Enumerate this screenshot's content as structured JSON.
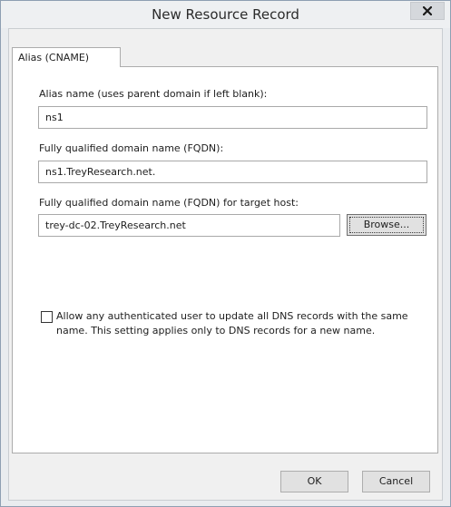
{
  "window": {
    "title": "New Resource Record"
  },
  "tabs": [
    {
      "label": "Alias (CNAME)",
      "selected": true
    }
  ],
  "form": {
    "alias_label": "Alias name (uses parent domain if left blank):",
    "alias_value": "ns1",
    "fqdn_label": "Fully qualified domain name (FQDN):",
    "fqdn_value": "ns1.TreyResearch.net.",
    "target_label": "Fully qualified domain name (FQDN) for target host:",
    "target_value": "trey-dc-02.TreyResearch.net",
    "browse_label": "Browse...",
    "allow_update_checked": false,
    "allow_update_line1": "Allow any authenticated user to update all DNS records with the same",
    "allow_update_line2": "name. This setting applies only to DNS records for a new name."
  },
  "footer": {
    "ok_label": "OK",
    "cancel_label": "Cancel"
  }
}
